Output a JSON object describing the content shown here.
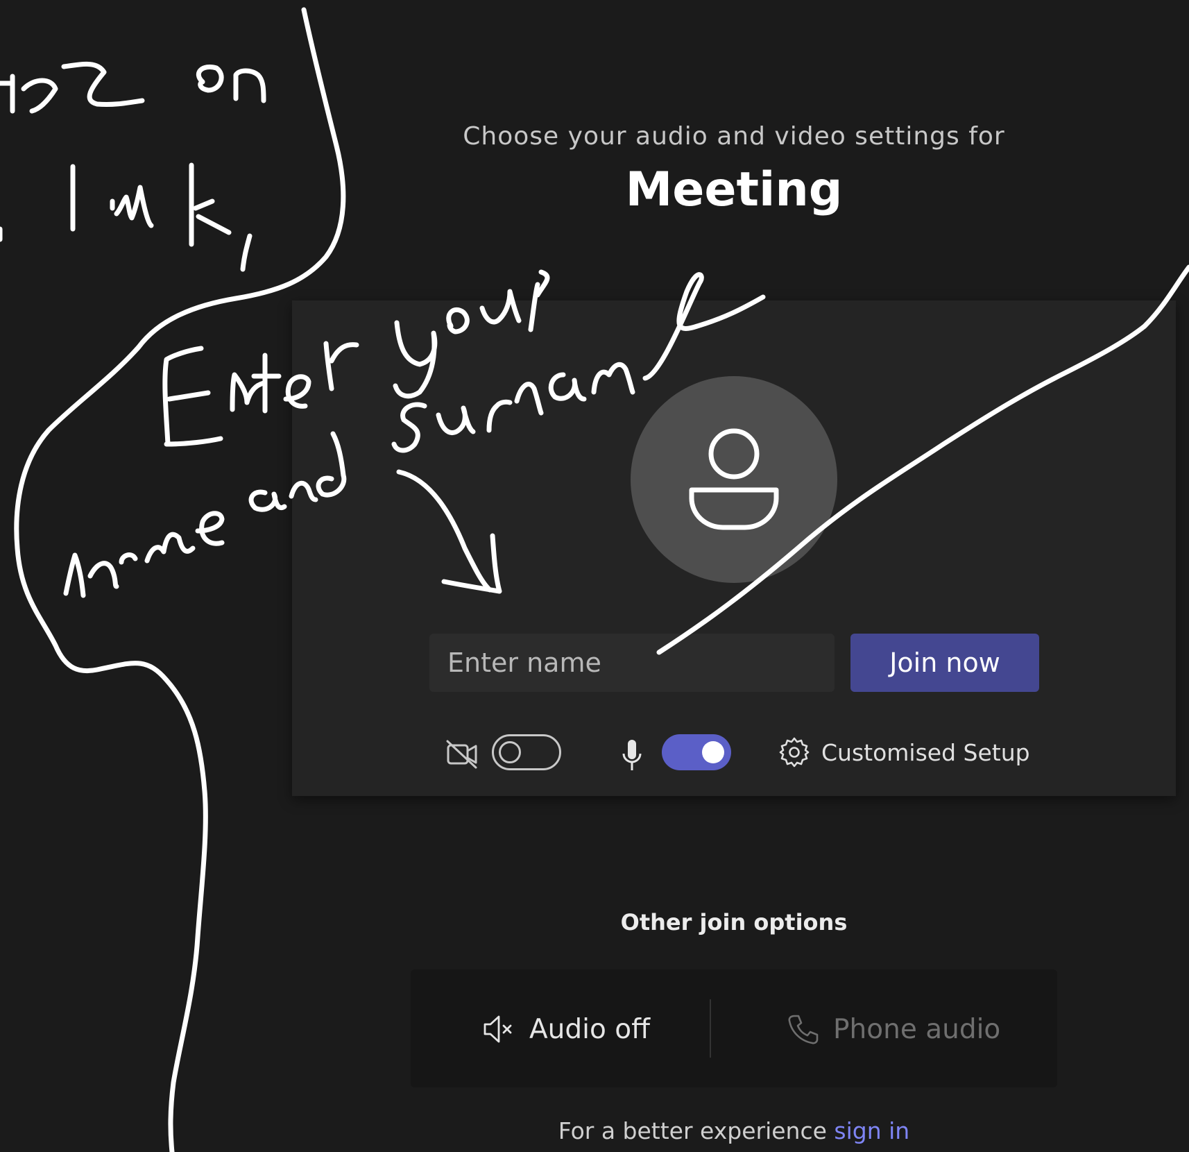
{
  "header": {
    "subtitle": "Choose your audio and video settings for",
    "title": "Meeting"
  },
  "prejoin": {
    "avatar_icon": "person-icon",
    "name_placeholder": "Enter name",
    "name_value": "",
    "join_label": "Join now",
    "video_icon": "video-off-icon",
    "video_enabled": false,
    "mic_icon": "microphone-icon",
    "mic_enabled": true,
    "settings_icon": "gear-icon",
    "custom_setup_label": "Customised Setup"
  },
  "other_options": {
    "title": "Other join options",
    "audio_off_icon": "speaker-mute-icon",
    "audio_off_label": "Audio off",
    "phone_icon": "phone-icon",
    "phone_label": "Phone audio"
  },
  "footer": {
    "text": "For a better experience ",
    "link": "sign in"
  },
  "colors": {
    "background": "#1b1b1b",
    "card": "#242424",
    "accent": "#444791",
    "toggle_on": "#5b5fc7",
    "link": "#7f85f5"
  }
}
